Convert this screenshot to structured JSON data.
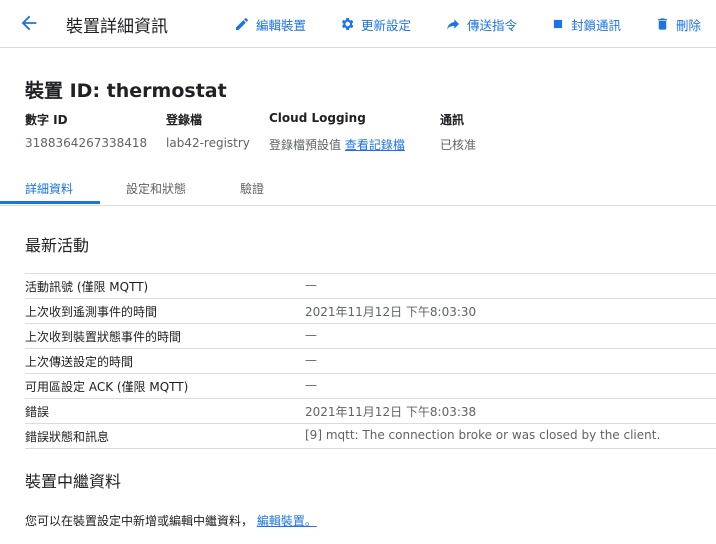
{
  "header": {
    "title": "裝置詳細資訊",
    "actions": [
      {
        "label": "編輯裝置",
        "icon": "pencil-icon"
      },
      {
        "label": "更新設定",
        "icon": "gear-icon"
      },
      {
        "label": "傳送指令",
        "icon": "share-arrow-icon"
      },
      {
        "label": "封鎖通訊",
        "icon": "stop-square-icon"
      },
      {
        "label": "刪除",
        "icon": "trash-icon"
      }
    ]
  },
  "device": {
    "heading": "裝置 ID: thermostat",
    "meta": [
      {
        "label": "數字 ID",
        "value": "3188364267338418"
      },
      {
        "label": "登錄檔",
        "value": "lab42-registry"
      },
      {
        "label": "Cloud Logging",
        "value": "登錄檔預設值",
        "link": "查看記錄檔"
      },
      {
        "label": "通訊",
        "value": "已核准"
      }
    ]
  },
  "tabs": [
    "詳細資料",
    "設定和狀態",
    "驗證"
  ],
  "activity": {
    "title": "最新活動",
    "rows": [
      {
        "key": "活動訊號 (僅限 MQTT)",
        "value": "—"
      },
      {
        "key": "上次收到遙測事件的時間",
        "value": "2021年11月12日 下午8:03:30"
      },
      {
        "key": "上次收到裝置狀態事件的時間",
        "value": "—"
      },
      {
        "key": "上次傳送設定的時間",
        "value": "—"
      },
      {
        "key": "可用區設定 ACK (僅限 MQTT)",
        "value": "—"
      },
      {
        "key": "錯誤",
        "value": "2021年11月12日 下午8:03:38"
      },
      {
        "key": "錯誤狀態和訊息",
        "value": "[9] mqtt: The connection broke or was closed by the client."
      }
    ]
  },
  "metadata": {
    "title": "裝置中繼資料",
    "note": "您可以在裝置設定中新增或編輯中繼資料，",
    "link": "編輯裝置。"
  }
}
